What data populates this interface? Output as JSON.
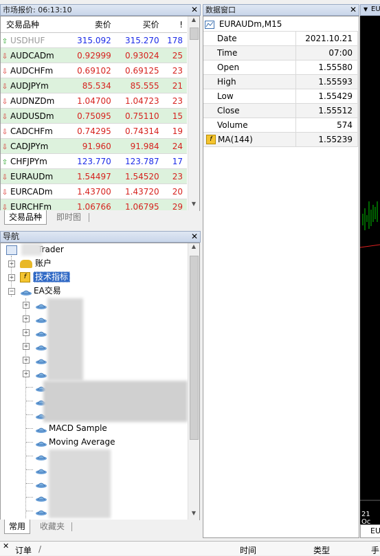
{
  "market_watch": {
    "title": "市场报价: 06:13:10",
    "columns": {
      "symbol": "交易品种",
      "bid": "卖价",
      "ask": "买价",
      "spread": "!"
    },
    "rows": [
      {
        "symbol": "USDHUF",
        "bid": "315.092",
        "ask": "315.270",
        "spread": "178",
        "dir": "up",
        "color": "blue",
        "symcolor": "grey"
      },
      {
        "symbol": "AUDCADm",
        "bid": "0.92999",
        "ask": "0.93024",
        "spread": "25",
        "dir": "down",
        "color": "red"
      },
      {
        "symbol": "AUDCHFm",
        "bid": "0.69102",
        "ask": "0.69125",
        "spread": "23",
        "dir": "down",
        "color": "red"
      },
      {
        "symbol": "AUDJPYm",
        "bid": "85.534",
        "ask": "85.555",
        "spread": "21",
        "dir": "down",
        "color": "red"
      },
      {
        "symbol": "AUDNZDm",
        "bid": "1.04700",
        "ask": "1.04723",
        "spread": "23",
        "dir": "down",
        "color": "red"
      },
      {
        "symbol": "AUDUSDm",
        "bid": "0.75095",
        "ask": "0.75110",
        "spread": "15",
        "dir": "down",
        "color": "red"
      },
      {
        "symbol": "CADCHFm",
        "bid": "0.74295",
        "ask": "0.74314",
        "spread": "19",
        "dir": "down",
        "color": "red"
      },
      {
        "symbol": "CADJPYm",
        "bid": "91.960",
        "ask": "91.984",
        "spread": "24",
        "dir": "down",
        "color": "red"
      },
      {
        "symbol": "CHFJPYm",
        "bid": "123.770",
        "ask": "123.787",
        "spread": "17",
        "dir": "up",
        "color": "blue"
      },
      {
        "symbol": "EURAUDm",
        "bid": "1.54497",
        "ask": "1.54520",
        "spread": "23",
        "dir": "down",
        "color": "red"
      },
      {
        "symbol": "EURCADm",
        "bid": "1.43700",
        "ask": "1.43720",
        "spread": "20",
        "dir": "down",
        "color": "red"
      },
      {
        "symbol": "EURCHFm",
        "bid": "1.06766",
        "ask": "1.06795",
        "spread": "29",
        "dir": "down",
        "color": "red"
      }
    ],
    "tabs": [
      "交易品种",
      "即时图"
    ]
  },
  "data_window": {
    "title": "数据窗口",
    "instrument": "EURAUDm,M15",
    "rows": [
      {
        "label": "Date",
        "value": "2021.10.21"
      },
      {
        "label": "Time",
        "value": "07:00"
      },
      {
        "label": "Open",
        "value": "1.55580"
      },
      {
        "label": "High",
        "value": "1.55593"
      },
      {
        "label": "Low",
        "value": "1.55429"
      },
      {
        "label": "Close",
        "value": "1.55512"
      },
      {
        "label": "Volume",
        "value": "574"
      }
    ],
    "indicator": {
      "label": "MA(144)",
      "value": "1.55239"
    }
  },
  "navigator": {
    "title": "导航",
    "root": "Trader",
    "accounts": "账户",
    "indicators": "技术指标",
    "ea": "EA交易",
    "ea_items": [
      "MACD Sample",
      "Moving Average"
    ],
    "tabs": [
      "常用",
      "收藏夹"
    ]
  },
  "chart": {
    "tab_label": "EU",
    "date_label": "21 Oc"
  },
  "terminal": {
    "orders": "订单",
    "time": "时间",
    "type": "类型",
    "hand": "手"
  },
  "colors": {
    "up": "#1c9e1c",
    "down": "#d6221e",
    "bid_blue": "#1c2be8",
    "selected": "#316ac5"
  }
}
